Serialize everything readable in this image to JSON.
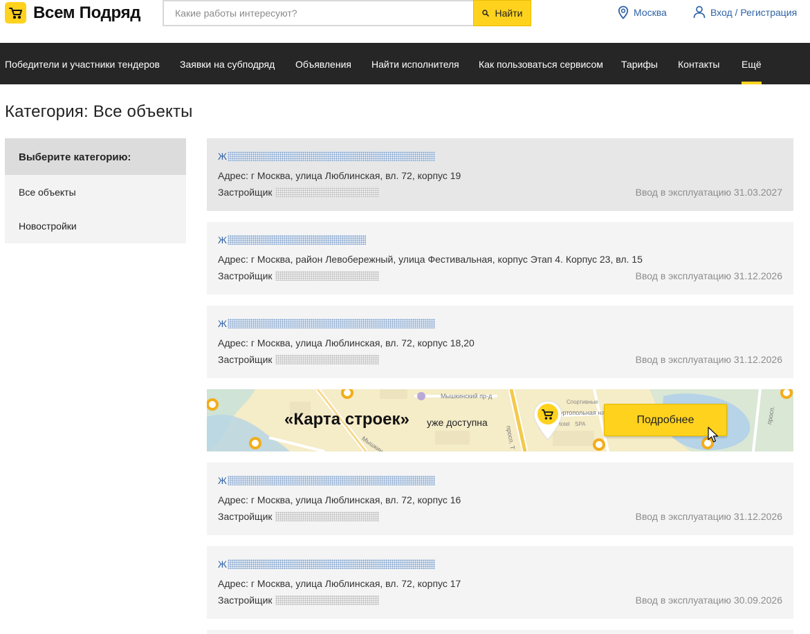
{
  "header": {
    "logo_text": "Всем Подряд",
    "search": {
      "placeholder": "Какие работы интересуют?",
      "button_label": "Найти"
    },
    "city_label": "Москва",
    "login_label": "Вход / Регистрация"
  },
  "nav": {
    "items": [
      {
        "label": "Победители и участники тендеров"
      },
      {
        "label": "Заявки на субподряд"
      },
      {
        "label": "Объявления"
      },
      {
        "label": "Найти исполнителя"
      },
      {
        "label": "Как пользоваться сервисом"
      },
      {
        "label": "Тарифы"
      },
      {
        "label": "Контакты"
      },
      {
        "label": "Ещё",
        "active": true
      }
    ]
  },
  "page_title": "Категория: Все объекты",
  "sidebar": {
    "heading": "Выберите категорию:",
    "items": [
      {
        "label": "Все объекты"
      },
      {
        "label": "Новостройки"
      }
    ]
  },
  "listings": [
    {
      "title_prefix": "Ж",
      "address": "Адрес: г Москва, улица Люблинская, вл. 72, корпус 19",
      "developer_label": "Застройщик",
      "date": "Ввод в эксплуатацию 31.03.2027"
    },
    {
      "title_prefix": "Ж",
      "address": "Адрес: г Москва, район Левобережный, улица Фестивальная, корпус Этап 4. Корпус 23, вл. 15",
      "developer_label": "Застройщик",
      "date": "Ввод в эксплуатацию 31.12.2026"
    },
    {
      "title_prefix": "Ж",
      "address": "Адрес: г Москва, улица Люблинская, вл. 72, корпус 18,20",
      "developer_label": "Застройщик",
      "date": "Ввод в эксплуатацию 31.12.2026"
    },
    {
      "title_prefix": "Ж",
      "address": "Адрес: г Москва, улица Люблинская, вл. 72, корпус 16",
      "developer_label": "Застройщик",
      "date": "Ввод в эксплуатацию 31.12.2026"
    },
    {
      "title_prefix": "Ж",
      "address": "Адрес: г Москва, улица Люблинская, вл. 72, корпус 17",
      "developer_label": "Застройщик",
      "date": "Ввод в эксплуатацию 30.09.2026"
    }
  ],
  "banner": {
    "title": "«Карта строек»",
    "subtitle": "уже доступна",
    "button_label": "Подробнее",
    "map_labels": {
      "street_1": "Мышкинский пр-д",
      "street_2": "Сортопольная наб",
      "street_3": "Мышкин",
      "street_4": "просп. Т",
      "street_5": "просп.",
      "poi_1": "SPA",
      "poi_2": "Hotel",
      "poi_3": "Спортивные"
    }
  },
  "icons": {
    "logo": "wheelbarrow-icon",
    "search": "search-icon",
    "city": "location-pin-icon",
    "login": "user-icon",
    "banner_pin": "map-marker-icon",
    "cursor": "mouse-cursor-icon"
  },
  "colors": {
    "brand_yellow": "#ffd21e",
    "nav_background": "#262626",
    "link_blue": "#2f63a6",
    "muted_text": "#8c8c8c"
  }
}
